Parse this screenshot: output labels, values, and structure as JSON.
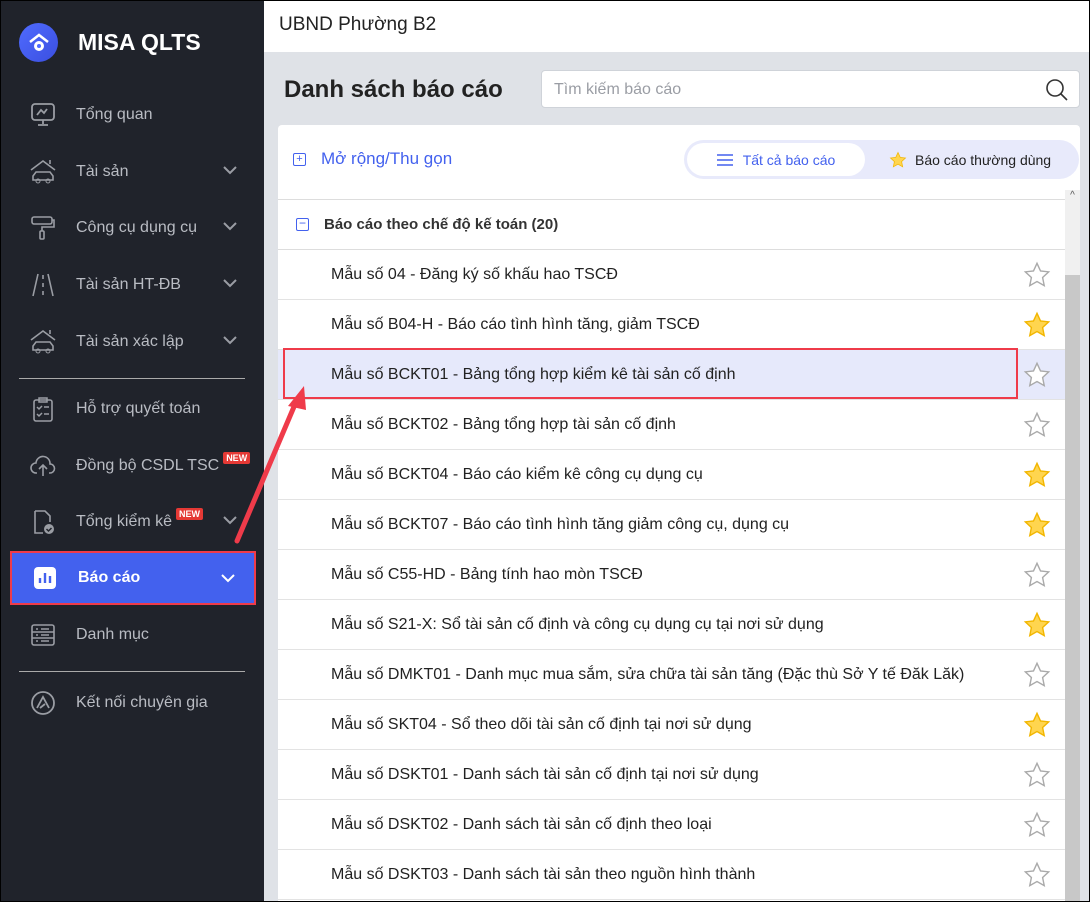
{
  "app": {
    "name": "MISA QLTS",
    "org": "UBND Phường B2"
  },
  "sidebar": {
    "items": [
      {
        "label": "Tổng quan",
        "icon": "monitor-chart-icon"
      },
      {
        "label": "Tài sản",
        "icon": "house-car-icon",
        "chevron": true
      },
      {
        "label": "Công cụ dụng cụ",
        "icon": "paint-roller-icon",
        "chevron": true
      },
      {
        "label": "Tài sản HT-ĐB",
        "icon": "road-icon",
        "chevron": true
      },
      {
        "label": "Tài sản xác lập",
        "icon": "house-car-icon",
        "chevron": true
      },
      {
        "label": "Hỗ trợ quyết toán",
        "icon": "clipboard-check-icon"
      },
      {
        "label": "Đồng bộ CSDL TSC",
        "icon": "cloud-upload-icon",
        "badge": "NEW"
      },
      {
        "label": "Tổng kiểm kê",
        "icon": "document-check-icon",
        "badge": "NEW",
        "chevron": true
      },
      {
        "label": "Báo cáo",
        "icon": "bar-chart-icon",
        "chevron": true,
        "active": true
      },
      {
        "label": "Danh mục",
        "icon": "list-icon"
      },
      {
        "label": "Kết nối chuyên gia",
        "icon": "expert-icon"
      }
    ]
  },
  "main": {
    "title": "Danh sách báo cáo",
    "search_placeholder": "Tìm kiếm báo cáo",
    "expand_label": "Mở rộng/Thu gọn",
    "tabs": [
      {
        "label": "Tất cả báo cáo",
        "active": true
      },
      {
        "label": "Báo cáo thường dùng"
      }
    ],
    "group": "Báo cáo theo chế độ kế toán (20)",
    "reports": [
      {
        "label": "Mẫu số 04 - Đăng ký số khấu hao TSCĐ",
        "starred": false
      },
      {
        "label": "Mẫu số B04-H - Báo cáo tình hình tăng, giảm TSCĐ",
        "starred": true
      },
      {
        "label": "Mẫu số BCKT01 - Bảng tổng hợp kiểm kê tài sản cố định",
        "starred": false,
        "highlighted": true
      },
      {
        "label": "Mẫu số BCKT02 - Bảng tổng hợp tài sản cố định",
        "starred": false
      },
      {
        "label": "Mẫu số BCKT04 - Báo cáo kiểm kê công cụ dụng cụ",
        "starred": true
      },
      {
        "label": "Mẫu số BCKT07 - Báo cáo tình hình tăng giảm công cụ, dụng cụ",
        "starred": true
      },
      {
        "label": "Mẫu số C55-HD - Bảng tính hao mòn TSCĐ",
        "starred": false
      },
      {
        "label": "Mẫu số S21-X: Sổ tài sản cố định và công cụ dụng cụ tại nơi sử dụng",
        "starred": true
      },
      {
        "label": "Mẫu số DMKT01 - Danh mục mua sắm, sửa chữa tài sản tăng (Đặc thù Sở Y tế Đăk Lăk)",
        "starred": false
      },
      {
        "label": "Mẫu số SKT04 - Sổ theo dõi tài sản cố định tại nơi sử dụng",
        "starred": true
      },
      {
        "label": "Mẫu số DSKT01 - Danh sách tài sản cố định tại nơi sử dụng",
        "starred": false
      },
      {
        "label": "Mẫu số DSKT02 - Danh sách tài sản cố định theo loại",
        "starred": false
      },
      {
        "label": "Mẫu số DSKT03 - Danh sách tài sản theo nguồn hình thành",
        "starred": false
      }
    ]
  },
  "colors": {
    "accent": "#4361ee",
    "sidebar": "#20232b",
    "highlight": "#ef3b4a",
    "star": "#ffd54f"
  }
}
